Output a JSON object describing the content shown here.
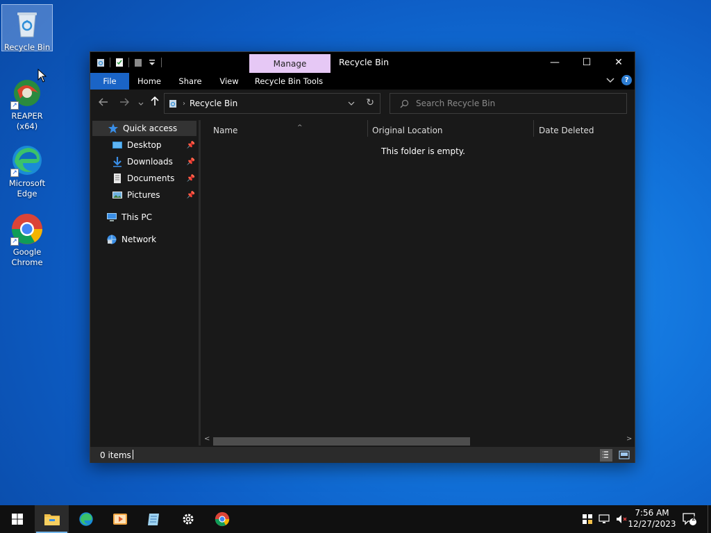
{
  "colors": {
    "desktop": "#1273db",
    "window_bg": "#191919",
    "titlebar": "#000000",
    "manage_tab": "#e6c8f5",
    "file_tab": "#1a64c6",
    "taskbar": "#101010",
    "accent": "#76b9ed"
  },
  "desktop": {
    "icons": [
      {
        "label": "Recycle Bin",
        "icon": "recycle-bin-icon",
        "selected": true
      },
      {
        "label": "REAPER (x64)",
        "icon": "reaper-icon"
      },
      {
        "label": "Microsoft Edge",
        "icon": "edge-icon"
      },
      {
        "label": "Google Chrome",
        "icon": "chrome-icon"
      }
    ]
  },
  "window": {
    "title": "Recycle Bin",
    "manage_tab": "Manage",
    "controls": {
      "minimize": "—",
      "maximize": "☐",
      "close": "✕"
    },
    "ribbon_tabs": [
      {
        "label": "File",
        "active": true
      },
      {
        "label": "Home"
      },
      {
        "label": "Share"
      },
      {
        "label": "View"
      },
      {
        "label": "Recycle Bin Tools"
      }
    ],
    "ribbon_help": "?",
    "address": {
      "segment": "Recycle Bin"
    },
    "search": {
      "placeholder": "Search Recycle Bin"
    },
    "nav": {
      "quick_access": "Quick access",
      "pinned": [
        {
          "label": "Desktop",
          "icon": "desktop-folder-icon"
        },
        {
          "label": "Downloads",
          "icon": "downloads-icon"
        },
        {
          "label": "Documents",
          "icon": "documents-icon"
        },
        {
          "label": "Pictures",
          "icon": "pictures-icon"
        }
      ],
      "this_pc": "This PC",
      "network": "Network"
    },
    "columns": [
      "Name",
      "Original Location",
      "Date Deleted"
    ],
    "empty_message": "This folder is empty.",
    "status": {
      "items": "0 items"
    }
  },
  "taskbar": {
    "apps": [
      "start-icon",
      "file-explorer-icon",
      "edge-icon",
      "media-player-icon",
      "notepad-icon",
      "settings-icon",
      "chrome-icon"
    ],
    "clock": {
      "time": "7:56 AM",
      "date": "12/27/2023"
    },
    "notification_count": "2"
  }
}
